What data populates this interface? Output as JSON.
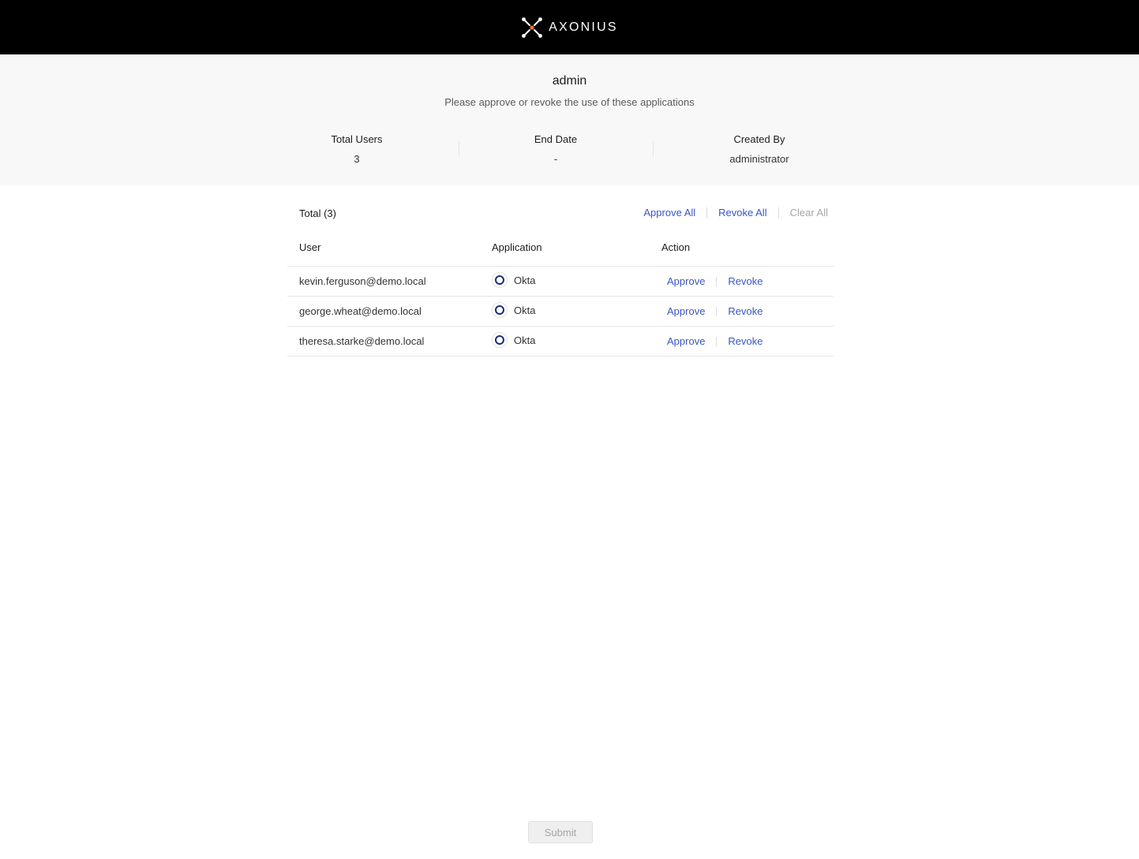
{
  "brand": {
    "logo_text": "AXONIUS",
    "logo_accent": "#e8743b"
  },
  "header": {
    "title": "admin",
    "subtitle": "Please approve or revoke the use of these applications",
    "stats": [
      {
        "label": "Total Users",
        "value": "3"
      },
      {
        "label": "End Date",
        "value": "-"
      },
      {
        "label": "Created By",
        "value": "administrator"
      }
    ]
  },
  "table": {
    "total_label": "Total (3)",
    "bulk_actions": {
      "approve_all": "Approve All",
      "revoke_all": "Revoke All",
      "clear_all": "Clear All"
    },
    "columns": {
      "user": "User",
      "application": "Application",
      "action": "Action"
    },
    "rows": [
      {
        "user": "kevin.ferguson@demo.local",
        "app": "Okta",
        "approve": "Approve",
        "revoke": "Revoke"
      },
      {
        "user": "george.wheat@demo.local",
        "app": "Okta",
        "approve": "Approve",
        "revoke": "Revoke"
      },
      {
        "user": "theresa.starke@demo.local",
        "app": "Okta",
        "approve": "Approve",
        "revoke": "Revoke"
      }
    ]
  },
  "footer": {
    "submit_label": "Submit"
  },
  "colors": {
    "link": "#3b55c4",
    "disabled": "#a6a6a6",
    "topbar": "#000000",
    "band": "#f8f8f8"
  }
}
